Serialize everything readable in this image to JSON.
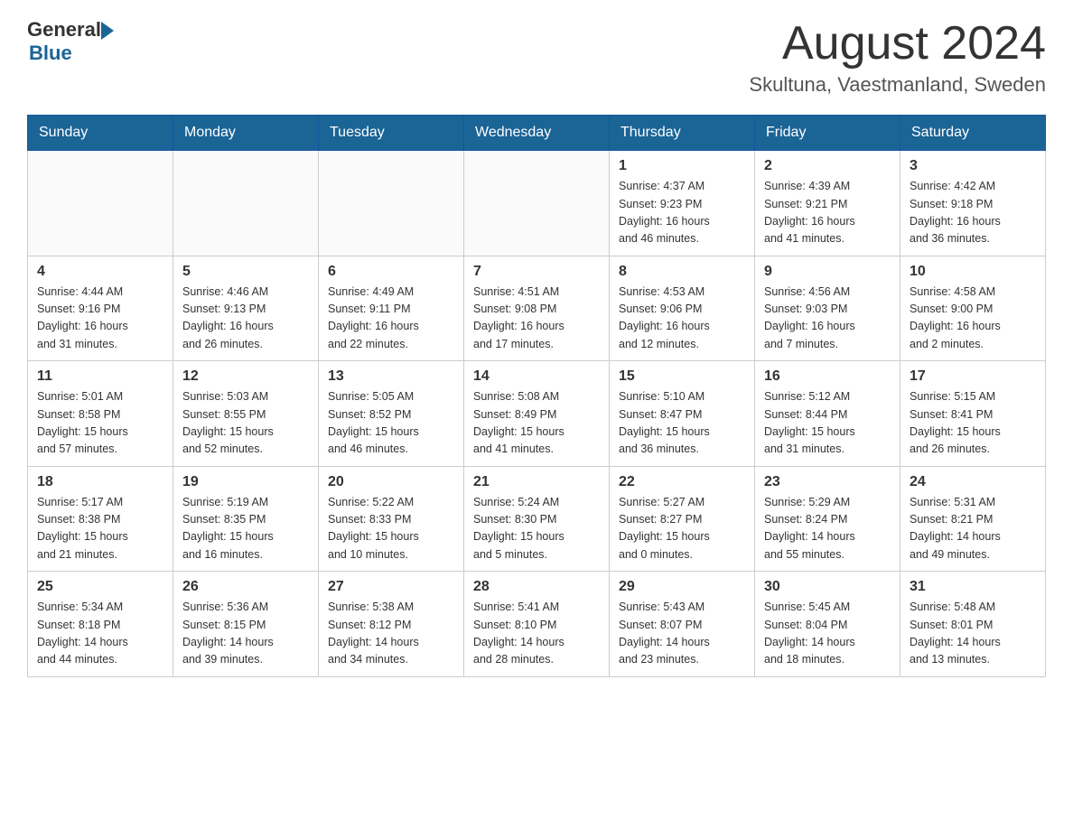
{
  "header": {
    "logo_general": "General",
    "logo_blue": "Blue",
    "title": "August 2024",
    "subtitle": "Skultuna, Vaestmanland, Sweden"
  },
  "days_of_week": [
    "Sunday",
    "Monday",
    "Tuesday",
    "Wednesday",
    "Thursday",
    "Friday",
    "Saturday"
  ],
  "weeks": [
    [
      {
        "day": "",
        "info": ""
      },
      {
        "day": "",
        "info": ""
      },
      {
        "day": "",
        "info": ""
      },
      {
        "day": "",
        "info": ""
      },
      {
        "day": "1",
        "info": "Sunrise: 4:37 AM\nSunset: 9:23 PM\nDaylight: 16 hours\nand 46 minutes."
      },
      {
        "day": "2",
        "info": "Sunrise: 4:39 AM\nSunset: 9:21 PM\nDaylight: 16 hours\nand 41 minutes."
      },
      {
        "day": "3",
        "info": "Sunrise: 4:42 AM\nSunset: 9:18 PM\nDaylight: 16 hours\nand 36 minutes."
      }
    ],
    [
      {
        "day": "4",
        "info": "Sunrise: 4:44 AM\nSunset: 9:16 PM\nDaylight: 16 hours\nand 31 minutes."
      },
      {
        "day": "5",
        "info": "Sunrise: 4:46 AM\nSunset: 9:13 PM\nDaylight: 16 hours\nand 26 minutes."
      },
      {
        "day": "6",
        "info": "Sunrise: 4:49 AM\nSunset: 9:11 PM\nDaylight: 16 hours\nand 22 minutes."
      },
      {
        "day": "7",
        "info": "Sunrise: 4:51 AM\nSunset: 9:08 PM\nDaylight: 16 hours\nand 17 minutes."
      },
      {
        "day": "8",
        "info": "Sunrise: 4:53 AM\nSunset: 9:06 PM\nDaylight: 16 hours\nand 12 minutes."
      },
      {
        "day": "9",
        "info": "Sunrise: 4:56 AM\nSunset: 9:03 PM\nDaylight: 16 hours\nand 7 minutes."
      },
      {
        "day": "10",
        "info": "Sunrise: 4:58 AM\nSunset: 9:00 PM\nDaylight: 16 hours\nand 2 minutes."
      }
    ],
    [
      {
        "day": "11",
        "info": "Sunrise: 5:01 AM\nSunset: 8:58 PM\nDaylight: 15 hours\nand 57 minutes."
      },
      {
        "day": "12",
        "info": "Sunrise: 5:03 AM\nSunset: 8:55 PM\nDaylight: 15 hours\nand 52 minutes."
      },
      {
        "day": "13",
        "info": "Sunrise: 5:05 AM\nSunset: 8:52 PM\nDaylight: 15 hours\nand 46 minutes."
      },
      {
        "day": "14",
        "info": "Sunrise: 5:08 AM\nSunset: 8:49 PM\nDaylight: 15 hours\nand 41 minutes."
      },
      {
        "day": "15",
        "info": "Sunrise: 5:10 AM\nSunset: 8:47 PM\nDaylight: 15 hours\nand 36 minutes."
      },
      {
        "day": "16",
        "info": "Sunrise: 5:12 AM\nSunset: 8:44 PM\nDaylight: 15 hours\nand 31 minutes."
      },
      {
        "day": "17",
        "info": "Sunrise: 5:15 AM\nSunset: 8:41 PM\nDaylight: 15 hours\nand 26 minutes."
      }
    ],
    [
      {
        "day": "18",
        "info": "Sunrise: 5:17 AM\nSunset: 8:38 PM\nDaylight: 15 hours\nand 21 minutes."
      },
      {
        "day": "19",
        "info": "Sunrise: 5:19 AM\nSunset: 8:35 PM\nDaylight: 15 hours\nand 16 minutes."
      },
      {
        "day": "20",
        "info": "Sunrise: 5:22 AM\nSunset: 8:33 PM\nDaylight: 15 hours\nand 10 minutes."
      },
      {
        "day": "21",
        "info": "Sunrise: 5:24 AM\nSunset: 8:30 PM\nDaylight: 15 hours\nand 5 minutes."
      },
      {
        "day": "22",
        "info": "Sunrise: 5:27 AM\nSunset: 8:27 PM\nDaylight: 15 hours\nand 0 minutes."
      },
      {
        "day": "23",
        "info": "Sunrise: 5:29 AM\nSunset: 8:24 PM\nDaylight: 14 hours\nand 55 minutes."
      },
      {
        "day": "24",
        "info": "Sunrise: 5:31 AM\nSunset: 8:21 PM\nDaylight: 14 hours\nand 49 minutes."
      }
    ],
    [
      {
        "day": "25",
        "info": "Sunrise: 5:34 AM\nSunset: 8:18 PM\nDaylight: 14 hours\nand 44 minutes."
      },
      {
        "day": "26",
        "info": "Sunrise: 5:36 AM\nSunset: 8:15 PM\nDaylight: 14 hours\nand 39 minutes."
      },
      {
        "day": "27",
        "info": "Sunrise: 5:38 AM\nSunset: 8:12 PM\nDaylight: 14 hours\nand 34 minutes."
      },
      {
        "day": "28",
        "info": "Sunrise: 5:41 AM\nSunset: 8:10 PM\nDaylight: 14 hours\nand 28 minutes."
      },
      {
        "day": "29",
        "info": "Sunrise: 5:43 AM\nSunset: 8:07 PM\nDaylight: 14 hours\nand 23 minutes."
      },
      {
        "day": "30",
        "info": "Sunrise: 5:45 AM\nSunset: 8:04 PM\nDaylight: 14 hours\nand 18 minutes."
      },
      {
        "day": "31",
        "info": "Sunrise: 5:48 AM\nSunset: 8:01 PM\nDaylight: 14 hours\nand 13 minutes."
      }
    ]
  ]
}
